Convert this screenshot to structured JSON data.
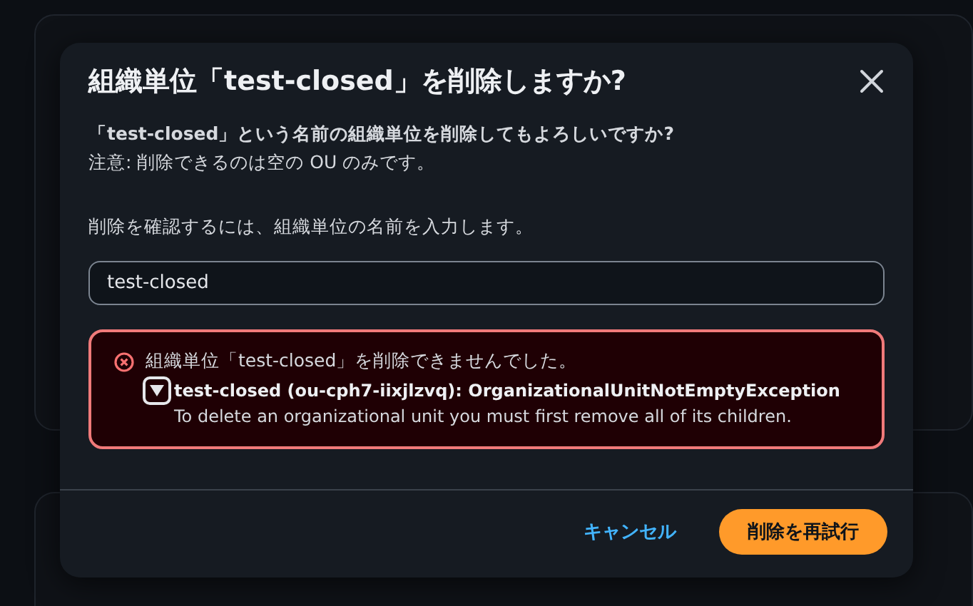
{
  "dialog": {
    "title": "組織単位「test-closed」を削除しますか?",
    "question": "「test-closed」という名前の組織単位を削除してもよろしいですか?",
    "note": "注意: 削除できるのは空の OU のみです。",
    "confirm_label": "削除を確認するには、組織単位の名前を入力します。",
    "confirm_input": {
      "value": "test-closed"
    },
    "error": {
      "message": "組織単位「test-closed」を削除できませんでした。",
      "details": [
        {
          "title": "test-closed (ou-cph7-iixjlzvq): OrganizationalUnitNotEmptyException",
          "expanded": true,
          "description": "To delete an organizational unit you must first remove all of its children."
        }
      ]
    },
    "buttons": [
      {
        "kind": "link",
        "label": "キャンセル"
      },
      {
        "kind": "primary",
        "label": "削除を再試行"
      }
    ]
  }
}
